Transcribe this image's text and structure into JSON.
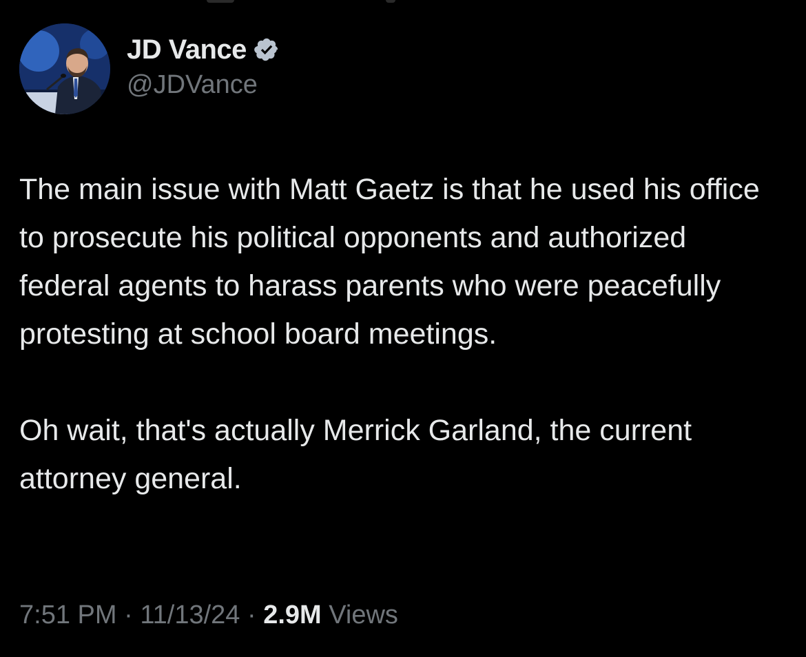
{
  "tweet": {
    "author": {
      "display_name": "JD Vance",
      "handle": "@JDVance",
      "verified": true,
      "avatar_icon": "profile-photo-avatar"
    },
    "paragraphs": [
      "The main issue with Matt Gaetz is that he used his office to prosecute his political opponents and authorized federal agents to harass parents who were peacefully protesting at school board meetings.",
      "Oh wait, that's actually Merrick Garland, the current attorney general."
    ],
    "meta": {
      "time": "7:51 PM",
      "separator": "·",
      "date": "11/13/24",
      "views_count": "2.9M",
      "views_label": "Views"
    }
  },
  "colors": {
    "background": "#000000",
    "primary_text": "#e7e9ea",
    "secondary_text": "#71767b",
    "verified_badge": "#b9c3cf"
  }
}
